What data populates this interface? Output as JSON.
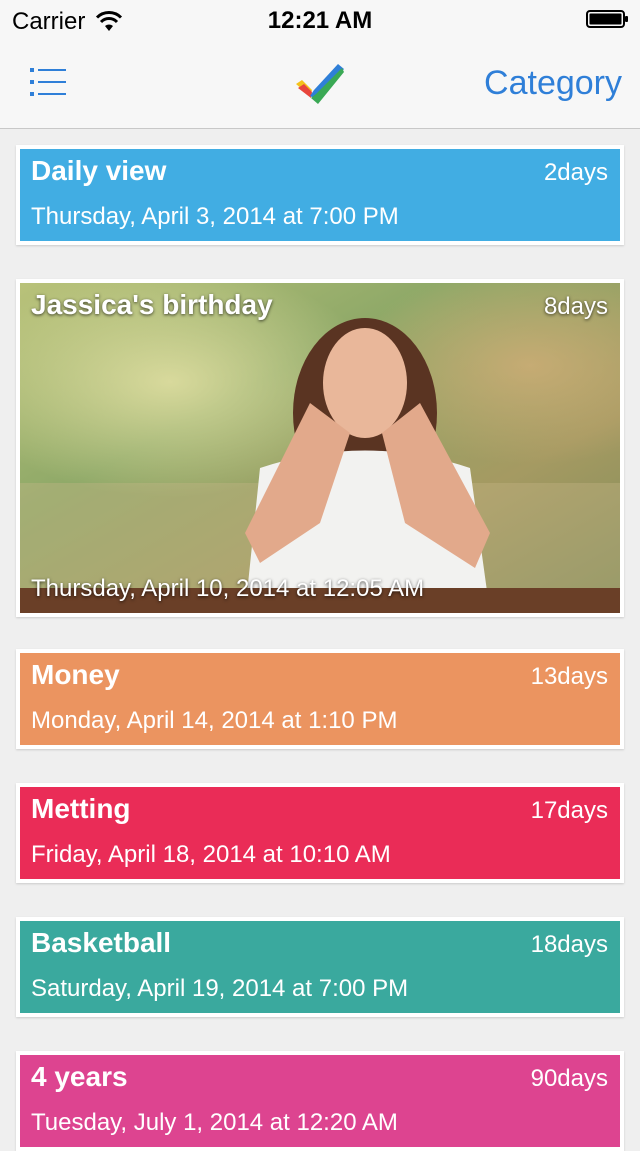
{
  "status_bar": {
    "carrier": "Carrier",
    "time": "12:21 AM"
  },
  "nav": {
    "category_label": "Category",
    "menu_icon": "list-menu-icon",
    "logo_icon": "checkmark-logo-icon"
  },
  "colors": {
    "accent": "#2f7fd8",
    "daily_view": "#41ade3",
    "money": "#eb9460",
    "meeting": "#ea2c57",
    "basketball": "#3aa99e",
    "four_years": "#dd4490"
  },
  "events": [
    {
      "title": "Daily view",
      "days": "2days",
      "date": "Thursday, April 3, 2014 at 7:00 PM"
    },
    {
      "title": "Jassica's birthday",
      "days": "8days",
      "date": "Thursday, April 10, 2014 at 12:05 AM"
    },
    {
      "title": "Money",
      "days": "13days",
      "date": "Monday, April 14, 2014 at 1:10 PM"
    },
    {
      "title": "Metting",
      "days": "17days",
      "date": "Friday, April 18, 2014 at 10:10 AM"
    },
    {
      "title": "Basketball",
      "days": "18days",
      "date": "Saturday, April 19, 2014 at 7:00 PM"
    },
    {
      "title": "4 years",
      "days": "90days",
      "date": "Tuesday, July 1, 2014 at 12:20 AM"
    }
  ]
}
